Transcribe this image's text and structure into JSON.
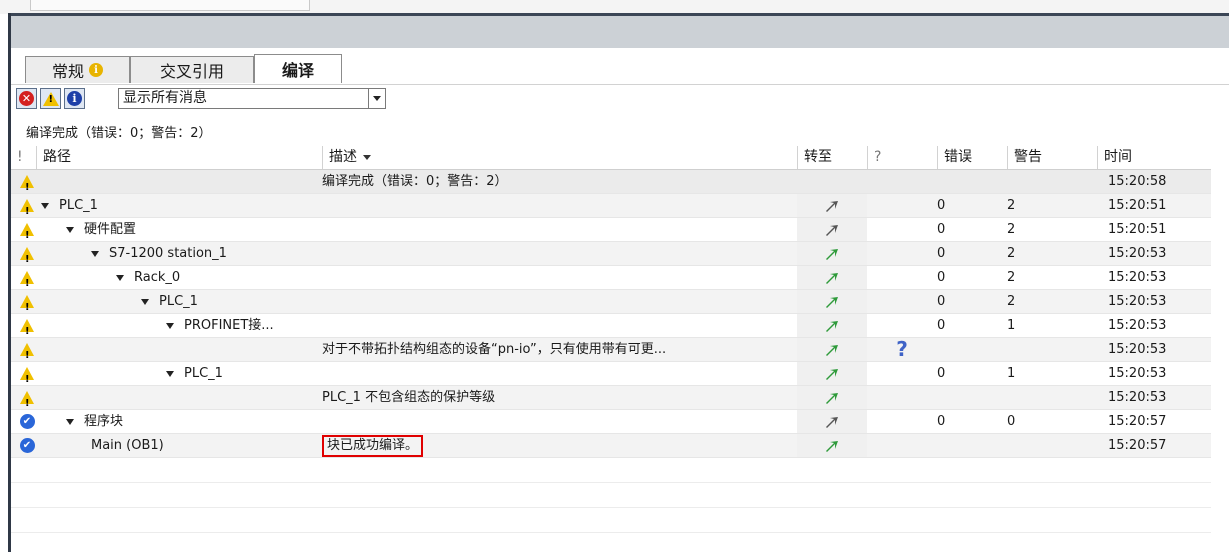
{
  "tabs": [
    {
      "label": "常规",
      "has_info_badge": true,
      "active": false
    },
    {
      "label": "交叉引用",
      "has_info_badge": false,
      "active": false
    },
    {
      "label": "编译",
      "has_info_badge": false,
      "active": true
    }
  ],
  "filter": {
    "buttons": [
      {
        "icon": "error-icon",
        "glyph": "✕"
      },
      {
        "icon": "warning-icon",
        "glyph": "!"
      },
      {
        "icon": "info-icon",
        "glyph": "i"
      }
    ],
    "select_value": "显示所有消息"
  },
  "summary": "编译完成（错误：0；警告：2）",
  "columns": {
    "status": "!",
    "path": "路径",
    "description": "描述",
    "goto": "转至",
    "help": "?",
    "errors": "错误",
    "warnings": "警告",
    "time": "时间"
  },
  "rows": [
    {
      "status": "warning",
      "indent": 0,
      "expander": false,
      "path": "",
      "description": "编译完成（错误：0；警告：2）",
      "goto": "",
      "help": "",
      "errors": "",
      "warnings": "",
      "time": "15:20:58"
    },
    {
      "status": "warning",
      "indent": 0,
      "expander": true,
      "path": "PLC_1",
      "description": "",
      "goto": "gray",
      "help": "",
      "errors": "0",
      "warnings": "2",
      "time": "15:20:51"
    },
    {
      "status": "warning",
      "indent": 1,
      "expander": true,
      "path": "硬件配置",
      "description": "",
      "goto": "gray",
      "help": "",
      "errors": "0",
      "warnings": "2",
      "time": "15:20:51"
    },
    {
      "status": "warning",
      "indent": 2,
      "expander": true,
      "path": "S7-1200 station_1",
      "description": "",
      "goto": "green",
      "help": "",
      "errors": "0",
      "warnings": "2",
      "time": "15:20:53"
    },
    {
      "status": "warning",
      "indent": 3,
      "expander": true,
      "path": "Rack_0",
      "description": "",
      "goto": "green",
      "help": "",
      "errors": "0",
      "warnings": "2",
      "time": "15:20:53"
    },
    {
      "status": "warning",
      "indent": 4,
      "expander": true,
      "path": "PLC_1",
      "description": "",
      "goto": "green",
      "help": "",
      "errors": "0",
      "warnings": "2",
      "time": "15:20:53"
    },
    {
      "status": "warning",
      "indent": 5,
      "expander": true,
      "path": "PROFINET接...",
      "description": "",
      "goto": "green",
      "help": "",
      "errors": "0",
      "warnings": "1",
      "time": "15:20:53"
    },
    {
      "status": "warning",
      "indent": 6,
      "expander": false,
      "path": "",
      "description": "对于不带拓扑结构组态的设备“pn-io”，只有使用带有可更...",
      "goto": "green",
      "help": "?",
      "errors": "",
      "warnings": "",
      "time": "15:20:53"
    },
    {
      "status": "warning",
      "indent": 5,
      "expander": true,
      "path": "PLC_1",
      "description": "",
      "goto": "green",
      "help": "",
      "errors": "0",
      "warnings": "1",
      "time": "15:20:53"
    },
    {
      "status": "warning",
      "indent": 6,
      "expander": false,
      "path": "",
      "description": "PLC_1 不包含组态的保护等级",
      "goto": "green",
      "help": "",
      "errors": "",
      "warnings": "",
      "time": "15:20:53"
    },
    {
      "status": "ok",
      "indent": 1,
      "expander": true,
      "path": "程序块",
      "description": "",
      "goto": "gray",
      "help": "",
      "errors": "0",
      "warnings": "0",
      "time": "15:20:57"
    },
    {
      "status": "ok",
      "indent": 2,
      "expander": false,
      "path": "Main (OB1)",
      "description": "块已成功编译。",
      "desc_highlighted": true,
      "goto": "green",
      "help": "",
      "errors": "",
      "warnings": "",
      "time": "15:20:57"
    }
  ],
  "colors": {
    "warning": "#f0c000",
    "ok": "#2a66d8",
    "error": "#d42020",
    "goto_green": "#2e9a3a",
    "goto_gray": "#555555",
    "highlight_border": "#e00000"
  }
}
